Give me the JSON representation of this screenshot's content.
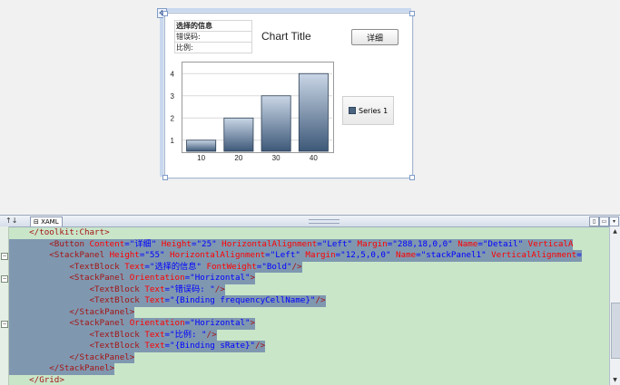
{
  "design": {
    "info_panel": {
      "title": "选择的信息",
      "error_code_label": "错误码:",
      "ratio_label": "比例:"
    },
    "chart_title": "Chart Title",
    "detail_button": "详细",
    "legend_entry": "Series 1"
  },
  "chart_data": {
    "type": "bar",
    "categories": [
      "10",
      "20",
      "30",
      "40"
    ],
    "values": [
      1,
      2,
      3,
      4
    ],
    "title": "Chart Title",
    "ylim": [
      0.5,
      4.5
    ],
    "yticks": [
      "1",
      "2",
      "3",
      "4"
    ],
    "series": [
      {
        "name": "Series 1",
        "values": [
          1,
          2,
          3,
          4
        ]
      }
    ],
    "legend": "right",
    "grid": true,
    "colors": {
      "bar_top": "#c9d6e6",
      "bar_bottom": "#3d5878"
    }
  },
  "editor": {
    "split_toggle": "↑↓",
    "tab_label": "XAML",
    "lines": [
      [
        [
          "tag",
          "    </toolkit:Chart>"
        ]
      ],
      [
        [
          "tag",
          "        <Button "
        ],
        [
          "attr",
          "Content"
        ],
        [
          "val",
          "=\"详细\" "
        ],
        [
          "attr",
          "Height"
        ],
        [
          "val",
          "=\"25\" "
        ],
        [
          "attr",
          "HorizontalAlignment"
        ],
        [
          "val",
          "=\"Left\" "
        ],
        [
          "attr",
          "Margin"
        ],
        [
          "val",
          "=\"288,18,0,0\" "
        ],
        [
          "attr",
          "Name"
        ],
        [
          "val",
          "=\"Detail\" "
        ],
        [
          "attr",
          "VerticalA"
        ]
      ],
      [
        [
          "tag",
          "        <StackPanel "
        ],
        [
          "attr",
          "Height"
        ],
        [
          "val",
          "=\"55\" "
        ],
        [
          "attr",
          "HorizontalAlignment"
        ],
        [
          "val",
          "=\"Left\" "
        ],
        [
          "attr",
          "Margin"
        ],
        [
          "val",
          "=\"12,5,0,0\" "
        ],
        [
          "attr",
          "Name"
        ],
        [
          "val",
          "=\"stackPanel1\" "
        ],
        [
          "attr",
          "VerticalAlignment"
        ],
        [
          "val",
          "="
        ]
      ],
      [
        [
          "tag",
          "            <TextBlock "
        ],
        [
          "attr",
          "Text"
        ],
        [
          "val",
          "=\"选择的信息\" "
        ],
        [
          "attr",
          "FontWeight"
        ],
        [
          "val",
          "=\"Bold\""
        ],
        [
          "tag",
          "/>"
        ]
      ],
      [
        [
          "tag",
          "            <StackPanel "
        ],
        [
          "attr",
          "Orientation"
        ],
        [
          "val",
          "=\"Horizontal\""
        ],
        [
          "tag",
          ">"
        ]
      ],
      [
        [
          "tag",
          "                <TextBlock "
        ],
        [
          "attr",
          "Text"
        ],
        [
          "val",
          "=\"错误码: \""
        ],
        [
          "tag",
          "/>"
        ]
      ],
      [
        [
          "tag",
          "                <TextBlock "
        ],
        [
          "attr",
          "Text"
        ],
        [
          "val",
          "=\"{Binding frequencyCellName}\""
        ],
        [
          "tag",
          "/>"
        ]
      ],
      [
        [
          "tag",
          "            </StackPanel>"
        ]
      ],
      [
        [
          "tag",
          "            <StackPanel "
        ],
        [
          "attr",
          "Orientation"
        ],
        [
          "val",
          "=\"Horizontal\""
        ],
        [
          "tag",
          ">"
        ]
      ],
      [
        [
          "tag",
          "                <TextBlock "
        ],
        [
          "attr",
          "Text"
        ],
        [
          "val",
          "=\"比例: \""
        ],
        [
          "tag",
          "/>"
        ]
      ],
      [
        [
          "tag",
          "                <TextBlock "
        ],
        [
          "attr",
          "Text"
        ],
        [
          "val",
          "=\"{Binding sRate}\""
        ],
        [
          "tag",
          "/>"
        ]
      ],
      [
        [
          "tag",
          "            </StackPanel>"
        ]
      ],
      [
        [
          "tag",
          "        </StackPanel>"
        ]
      ],
      [
        [
          "tag",
          "    </Grid>"
        ]
      ]
    ]
  }
}
